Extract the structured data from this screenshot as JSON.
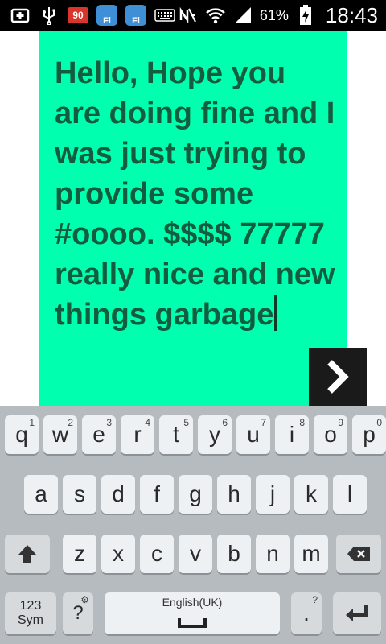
{
  "status_bar": {
    "badge": "90",
    "app1": "Fl",
    "app2": "Fl",
    "battery": "61%",
    "time": "18:43",
    "icons": [
      "add-box-icon",
      "usb-icon",
      "notification-badge",
      "app-icon",
      "app-icon",
      "keyboard-icon",
      "mute-icon",
      "wifi-icon",
      "signal-icon",
      "battery-icon"
    ]
  },
  "note": {
    "text": "Hello, Hope you are doing fine and I was just trying to provide some #oooo. $$$$ 77777 really nice and new things garbage",
    "background": "#00ffae",
    "text_color": "#135c3f"
  },
  "keyboard": {
    "row1": [
      {
        "label": "q",
        "hint": "1"
      },
      {
        "label": "w",
        "hint": "2"
      },
      {
        "label": "e",
        "hint": "3"
      },
      {
        "label": "r",
        "hint": "4"
      },
      {
        "label": "t",
        "hint": "5"
      },
      {
        "label": "y",
        "hint": "6"
      },
      {
        "label": "u",
        "hint": "7"
      },
      {
        "label": "i",
        "hint": "8"
      },
      {
        "label": "o",
        "hint": "9"
      },
      {
        "label": "p",
        "hint": "0"
      }
    ],
    "row2": [
      "a",
      "s",
      "d",
      "f",
      "g",
      "h",
      "j",
      "k",
      "l"
    ],
    "row3": [
      "z",
      "x",
      "c",
      "v",
      "b",
      "n",
      "m"
    ],
    "sym_label": "123\nSym",
    "question": "?",
    "question_hint": "⚙",
    "space_label": "English(UK)",
    "period": ".",
    "period_hint": "?"
  }
}
